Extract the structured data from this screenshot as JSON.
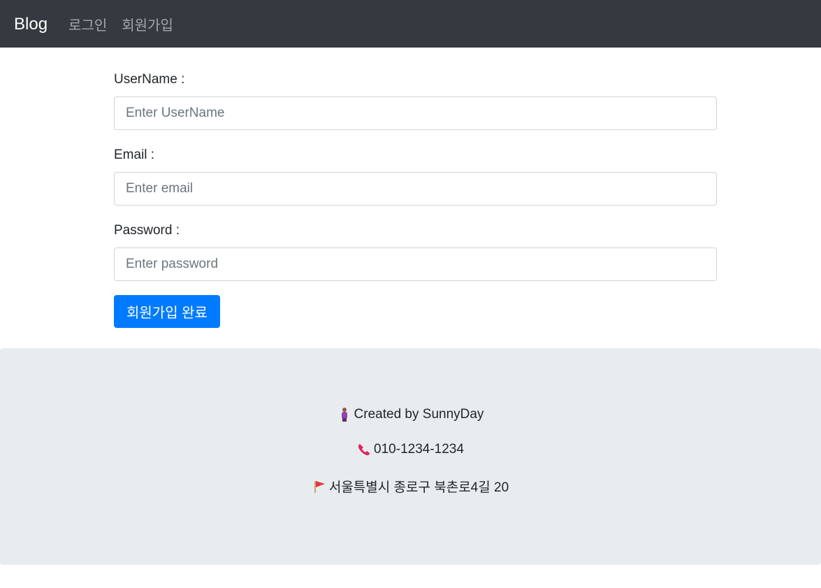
{
  "navbar": {
    "brand": "Blog",
    "links": [
      "로그인",
      "회원가입"
    ]
  },
  "form": {
    "username": {
      "label": "UserName :",
      "placeholder": "Enter UserName",
      "value": ""
    },
    "email": {
      "label": "Email :",
      "placeholder": "Enter email",
      "value": ""
    },
    "password": {
      "label": "Password :",
      "placeholder": "Enter password",
      "value": ""
    },
    "submit_label": "회원가입 완료"
  },
  "footer": {
    "created": {
      "icon": "person-icon",
      "text": "Created by SunnyDay"
    },
    "phone": {
      "icon": "phone-icon",
      "text": "010-1234-1234"
    },
    "address": {
      "icon": "flag-icon",
      "text": "서울특별시 종로구 북촌로4길 20"
    }
  },
  "colors": {
    "navbar_bg": "#343a40",
    "primary": "#007bff",
    "footer_bg": "#e9ecef"
  }
}
